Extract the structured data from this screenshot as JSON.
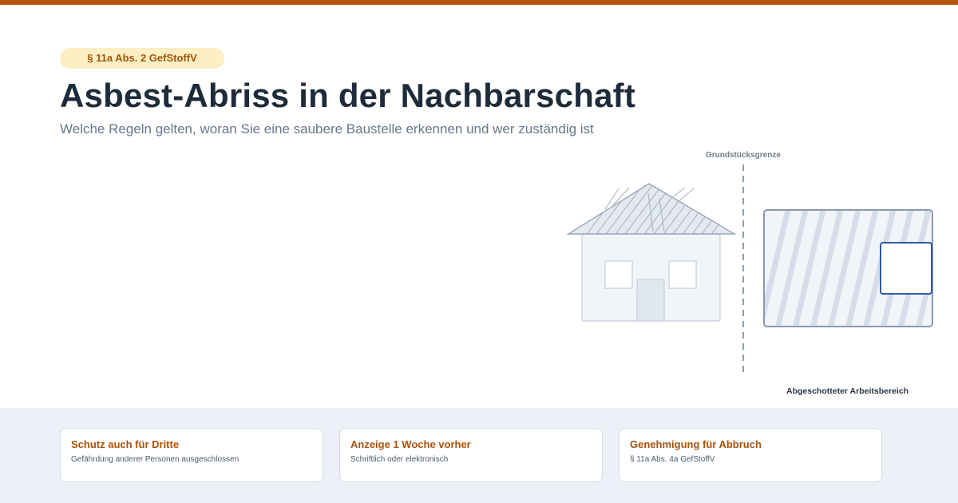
{
  "badge": "§ 11a Abs. 2 GefStoffV",
  "title": "Asbest-Abriss in der Nachbarschaft",
  "subtitle": "Welche Regeln gelten, woran Sie eine saubere Baustelle erkennen und wer zuständig ist",
  "illustration": {
    "boundary_label": "Grundstücksgrenze",
    "work_area_label": "Abgeschotteter Arbeitsbereich"
  },
  "cards": [
    {
      "title": "Schutz auch für Dritte",
      "text": "Gefährdung anderer Personen ausgeschlossen"
    },
    {
      "title": "Anzeige 1 Woche vorher",
      "text": "Schriftlich oder elektronisch"
    },
    {
      "title": "Genehmigung für Abbruch",
      "text": "§ 11a Abs. 4a GefStoffV"
    }
  ],
  "colors": {
    "accent": "#b5520f",
    "badge_bg": "#fcefc4",
    "title": "#1e2b3a",
    "subtitle": "#66778c",
    "strip_bg": "#edf0f6",
    "highlight_blue": "#2e5aa8"
  }
}
